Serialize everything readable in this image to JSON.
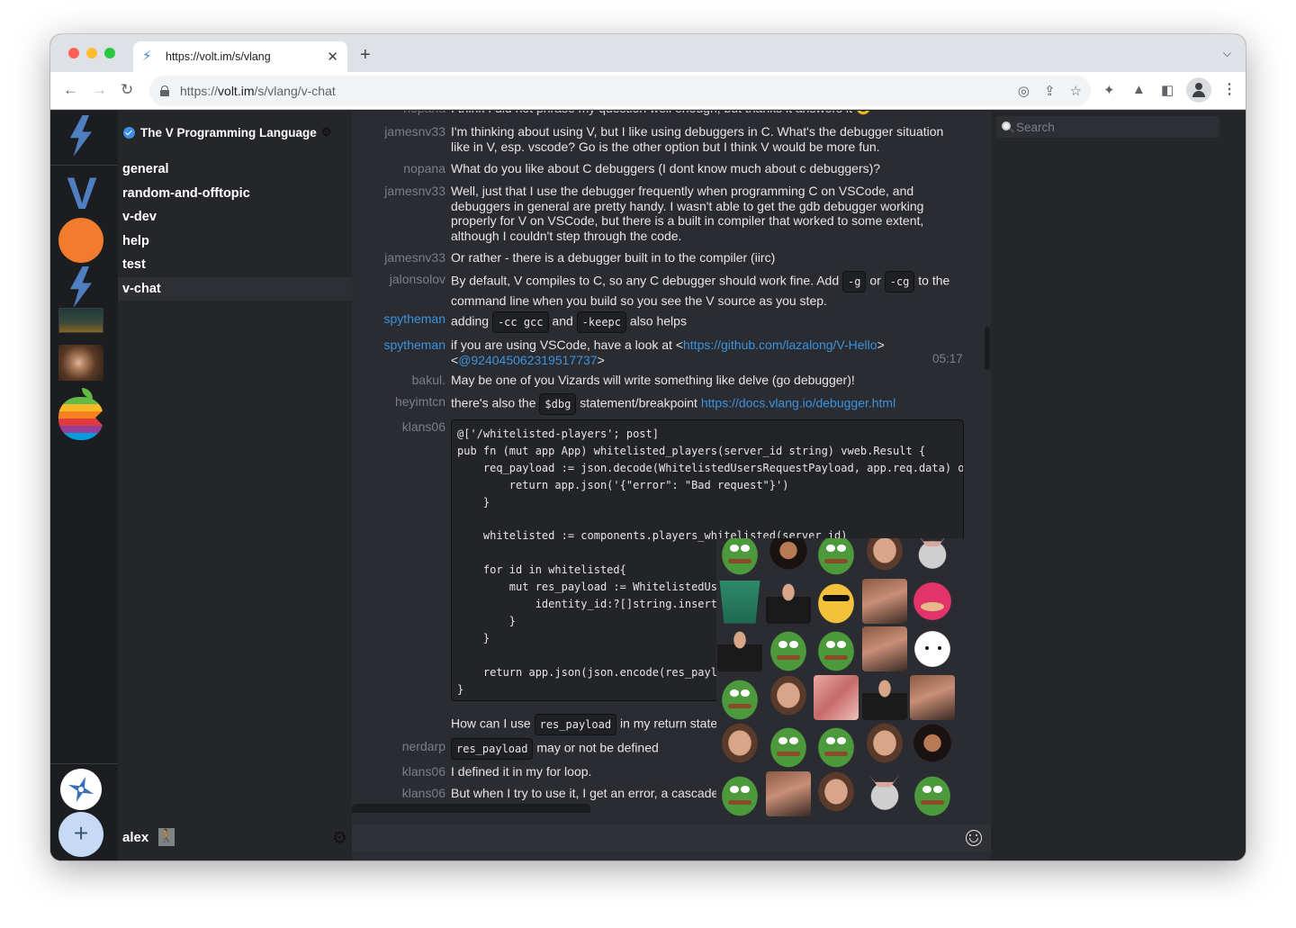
{
  "browser": {
    "tab": {
      "title": "https://volt.im/s/vlang",
      "favicon": "lightning-bolt-icon"
    },
    "new_tab_label": "+",
    "url": {
      "prefix": "https://",
      "host": "volt.im",
      "path": "/s/vlang/v-chat"
    },
    "toolbar_icons": [
      "eye-off-icon",
      "share-icon",
      "star-icon",
      "puzzle-icon",
      "flask-icon",
      "sidebar-icon",
      "profile-icon",
      "kebab-menu-icon"
    ],
    "traffic_lights": {
      "close": "#ff5f57",
      "minimize": "#febc2e",
      "maximize": "#28c840"
    }
  },
  "servers": [
    {
      "name": "volt-home",
      "icon": "lightning-bolt-icon"
    },
    {
      "name": "vlang",
      "icon": "v-logo-icon"
    },
    {
      "name": "orange-server",
      "icon": "orange-circle-icon"
    },
    {
      "name": "volt",
      "icon": "lightning-bolt-icon"
    },
    {
      "name": "elden-ring",
      "icon": "elden-ring-image"
    },
    {
      "name": "pascal",
      "icon": "portrait-image"
    },
    {
      "name": "apple",
      "icon": "apple-logo-icon"
    }
  ],
  "rail_bottom": {
    "explore_icon": "compass-icon",
    "add_label": "+"
  },
  "server": {
    "name": "The V Programming Language",
    "channels": [
      {
        "name": "general",
        "active": false
      },
      {
        "name": "random-and-offtopic",
        "active": false
      },
      {
        "name": "v-dev",
        "active": false
      },
      {
        "name": "help",
        "active": false
      },
      {
        "name": "test",
        "active": false
      },
      {
        "name": "v-chat",
        "active": true
      }
    ]
  },
  "user": {
    "name": "alex"
  },
  "search": {
    "placeholder": "Search"
  },
  "messages": [
    {
      "author": "nopana",
      "text": "I think I did not phrase my question well enough, but thanks it answers it 😊"
    },
    {
      "author": "jamesnv33",
      "text": "I'm thinking about using V, but I like using debuggers in C. What's the debugger situation like in V, esp. vscode? Go is the other option but I think V would be more fun."
    },
    {
      "author": "nopana",
      "text": "What do you like about C debuggers (I dont know much about c debuggers)?"
    },
    {
      "author": "jamesnv33",
      "text": "Well, just that I use the debugger frequently when programming C on VSCode, and debuggers in general are pretty handy. I wasn't able to get the gdb debugger working properly for V on VSCode, but there is a built in compiler that worked to some extent, although I couldn't step through the code."
    },
    {
      "author": "jamesnv33",
      "text": "Or rather - there is a debugger built in to the compiler (iirc)"
    },
    {
      "author": "jalonsolov",
      "parts": [
        "By default, V compiles to C, so any C debugger should work fine. Add ",
        "-g",
        " or ",
        "-cg",
        " to the command line when you build so you see the V source as you step."
      ]
    },
    {
      "author": "spytheman",
      "parts": [
        "adding ",
        "-cc gcc",
        " and ",
        "-keepc",
        " also helps"
      ]
    },
    {
      "author": "spytheman",
      "parts": [
        "if you are using VSCode, have a look at <",
        "https://github.com/lazalong/V-Hello",
        ">",
        "<",
        "@924045062319517737",
        ">"
      ],
      "time": "05:17"
    },
    {
      "author": "bakul.",
      "text": "May be one of you Vizards will write something like delve (go debugger)!"
    },
    {
      "author": "heyimtcn",
      "parts": [
        "there's also the ",
        "$dbg",
        " statement/breakpoint ",
        "https://docs.vlang.io/debugger.html"
      ]
    },
    {
      "author": "klans06",
      "code": "@['/whitelisted-players'; post]\npub fn (mut app App) whitelisted_players(server_id string) vweb.Result {\n    req_payload := json.decode(WhitelistedUsersRequestPayload, app.req.data) or {\n        return app.json('{\"error\": \"Bad request\"}')\n    }\n\n    whitelisted := components.players_whitelisted(server_id)\n\n    for id in whitelisted{\n        mut res_payload := WhitelistedUsersResponsePayload{\n            identity_id:?[]string.insert(id)\n        }\n    }\n\n    return app.json(json.encode(res_payload))\n}"
    },
    {
      "author": "",
      "parts": [
        "How can I use ",
        "res_payload",
        " in my return statement?"
      ]
    },
    {
      "author": "nerdarp",
      "parts": [
        "",
        "res_payload",
        " may or not be defined"
      ]
    },
    {
      "author": "klans06",
      "text": "I defined it in my for loop."
    },
    {
      "author": "klans06",
      "text": "But when I try to use it, I get an error, a cascade"
    }
  ],
  "emoji_picker": {
    "rows": [
      [
        "goblin",
        "bob-ross",
        "goblin-green",
        "angry-man",
        "grey-face"
      ],
      [
        "green-bin",
        "leo-laugh",
        "pepe-sunglasses",
        "roll-safe",
        "knuckles"
      ],
      [
        "rdj-eyeroll",
        "pepe-hands",
        "pepe-cry",
        "michael-scott",
        "monka-eyes"
      ],
      [
        "monka-s",
        "pog-champ",
        "lips",
        "leo-toast",
        "risitas-laugh"
      ],
      [
        "facepalm",
        "pepe-dino",
        "pepe-laugh",
        "kermit-man",
        "bob-ross-pixel"
      ],
      [
        "pepe-sit",
        "salute",
        "risitas",
        "kappa-cat",
        "pepe-happy"
      ]
    ]
  },
  "composer": {
    "placeholder": "",
    "emoji_button": "smiley-icon"
  }
}
